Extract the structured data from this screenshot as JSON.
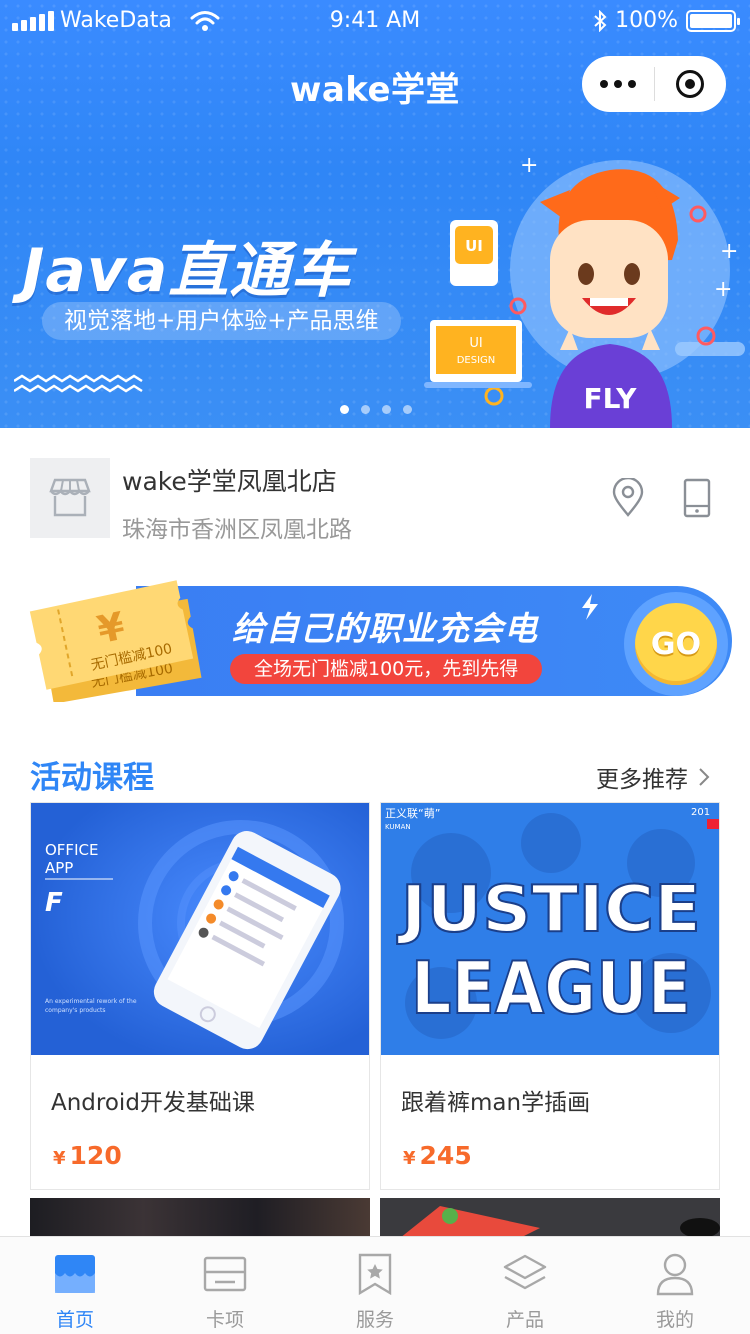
{
  "status_bar": {
    "carrier": "WakeData",
    "time": "9:41 AM",
    "battery": "100%"
  },
  "nav": {
    "title": "wake学堂"
  },
  "banner": {
    "title": "Java直通车",
    "subtitle": "视觉落地+用户体验+产品思维",
    "art_labels": {
      "ui_badge": "UI",
      "ui_design_top": "UI",
      "ui_design_bottom": "DESIGN",
      "shirt": "FLY"
    },
    "page_count": 4,
    "active_page": 1
  },
  "store": {
    "name": "wake学堂凤凰北店",
    "address": "珠海市香洲区凤凰北路"
  },
  "promo": {
    "ticket_symbol": "¥",
    "ticket_text": "无门槛减100",
    "ticket_back_text": "无门槛减100",
    "title": "给自己的职业充会电",
    "tag": "全场无门槛减100元，先到先得",
    "go": "GO"
  },
  "section": {
    "title": "活动课程",
    "more": "更多推荐"
  },
  "courses": [
    {
      "name": "Android开发基础课",
      "currency": "¥",
      "price": "120",
      "cover": {
        "line1": "OFFICE",
        "line2": "APP",
        "logo": "F",
        "caption1": "An experimental rework of the",
        "caption2": "company's products"
      }
    },
    {
      "name": "跟着裤man学插画",
      "currency": "¥",
      "price": "245",
      "cover": {
        "top_left": "正义联“萌”",
        "sub": "KUMAN",
        "corner": "201",
        "line1": "JUSTICE",
        "line2": "LEAGUE"
      }
    }
  ],
  "tabs": [
    {
      "label": "首页",
      "icon": "home-shop-icon",
      "active": true
    },
    {
      "label": "卡项",
      "icon": "card-icon",
      "active": false
    },
    {
      "label": "服务",
      "icon": "bookmark-star-icon",
      "active": false
    },
    {
      "label": "产品",
      "icon": "layers-icon",
      "active": false
    },
    {
      "label": "我的",
      "icon": "user-icon",
      "active": false
    }
  ],
  "colors": {
    "brand": "#2F86F6",
    "price": "#F76A2B",
    "promo_tag": "#F2453D",
    "go": "#FFD64A"
  }
}
